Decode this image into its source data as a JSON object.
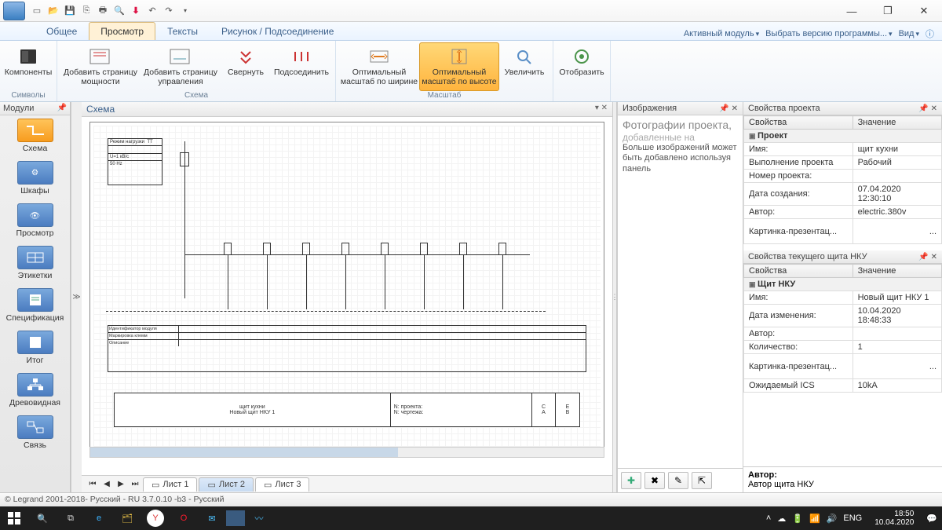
{
  "window": {
    "min": "—",
    "max": "❐",
    "close": "✕"
  },
  "ribbon": {
    "tabs": [
      "Общее",
      "Просмотр",
      "Тексты",
      "Рисунок / Подсоединение"
    ],
    "active_tab": "Просмотр",
    "right": {
      "module": "Активный модуль",
      "version": "Выбрать версию программы...",
      "view": "Вид"
    },
    "groups": {
      "symbols": {
        "label": "Символы",
        "components": "Компоненты"
      },
      "scheme": {
        "label": "Схема",
        "add_power": "Добавить страницу мощности",
        "add_ctrl": "Добавить страницу управления",
        "collapse": "Свернуть",
        "connect": "Подсоединить"
      },
      "scale": {
        "label": "Масштаб",
        "fit_w": "Оптимальный масштаб по ширине",
        "fit_h": "Оптимальный масштаб по высоте",
        "zoom": "Увеличить"
      },
      "display": {
        "label": "",
        "show": "Отобразить"
      }
    }
  },
  "sidebar": {
    "header": "Модули",
    "items": [
      {
        "label": "Схема"
      },
      {
        "label": "Шкафы"
      },
      {
        "label": "Просмотр"
      },
      {
        "label": "Этикетки"
      },
      {
        "label": "Спецификация"
      },
      {
        "label": "Итог"
      },
      {
        "label": "Древовидная"
      },
      {
        "label": "Связь"
      }
    ]
  },
  "center": {
    "title": "Схема",
    "sheet_tabs": [
      "Лист 1",
      "Лист 2",
      "Лист 3"
    ],
    "drawing": {
      "project": "щит кухни",
      "device": "Новый щит НКУ 1",
      "proj_no_lbl": "N: проекта:",
      "draw_no_lbl": "N: чертежа:",
      "C": "C",
      "E": "E",
      "A": "A",
      "B": "B"
    }
  },
  "images_panel": {
    "title": "Изображения",
    "heading": "Фотографии проекта,",
    "sub": "добавленные на",
    "note": "Больше изображений может быть добавлено используя панель"
  },
  "props_project": {
    "title": "Свойства проекта",
    "col_prop": "Свойства",
    "col_val": "Значение",
    "cat": "Проект",
    "rows": [
      {
        "k": "Имя:",
        "v": "щит кухни"
      },
      {
        "k": "Выполнение проекта",
        "v": "Рабочий"
      },
      {
        "k": "Номер проекта:",
        "v": ""
      },
      {
        "k": "Дата создания:",
        "v": "07.04.2020 12:30:10"
      },
      {
        "k": "Автор:",
        "v": "electric.380v"
      },
      {
        "k": "Картинка-презентац...",
        "v": "..."
      }
    ]
  },
  "props_device": {
    "title": "Свойства текущего щита НКУ",
    "col_prop": "Свойства",
    "col_val": "Значение",
    "cat": "Щит НКУ",
    "rows": [
      {
        "k": "Имя:",
        "v": "Новый щит НКУ 1"
      },
      {
        "k": "Дата изменения:",
        "v": "10.04.2020 18:48:33"
      },
      {
        "k": "Автор:",
        "v": ""
      },
      {
        "k": "Количество:",
        "v": "1"
      },
      {
        "k": "Картинка-презентац...",
        "v": "..."
      },
      {
        "k": "Ожидаемый ICS",
        "v": "10kA"
      }
    ],
    "help_title": "Автор:",
    "help_text": "Автор щита НКУ"
  },
  "status": "© Legrand 2001-2018- Русский - RU 3.7.0.10 -b3 - Русский",
  "taskbar": {
    "lang": "ENG",
    "time": "18:50",
    "date": "10.04.2020"
  }
}
